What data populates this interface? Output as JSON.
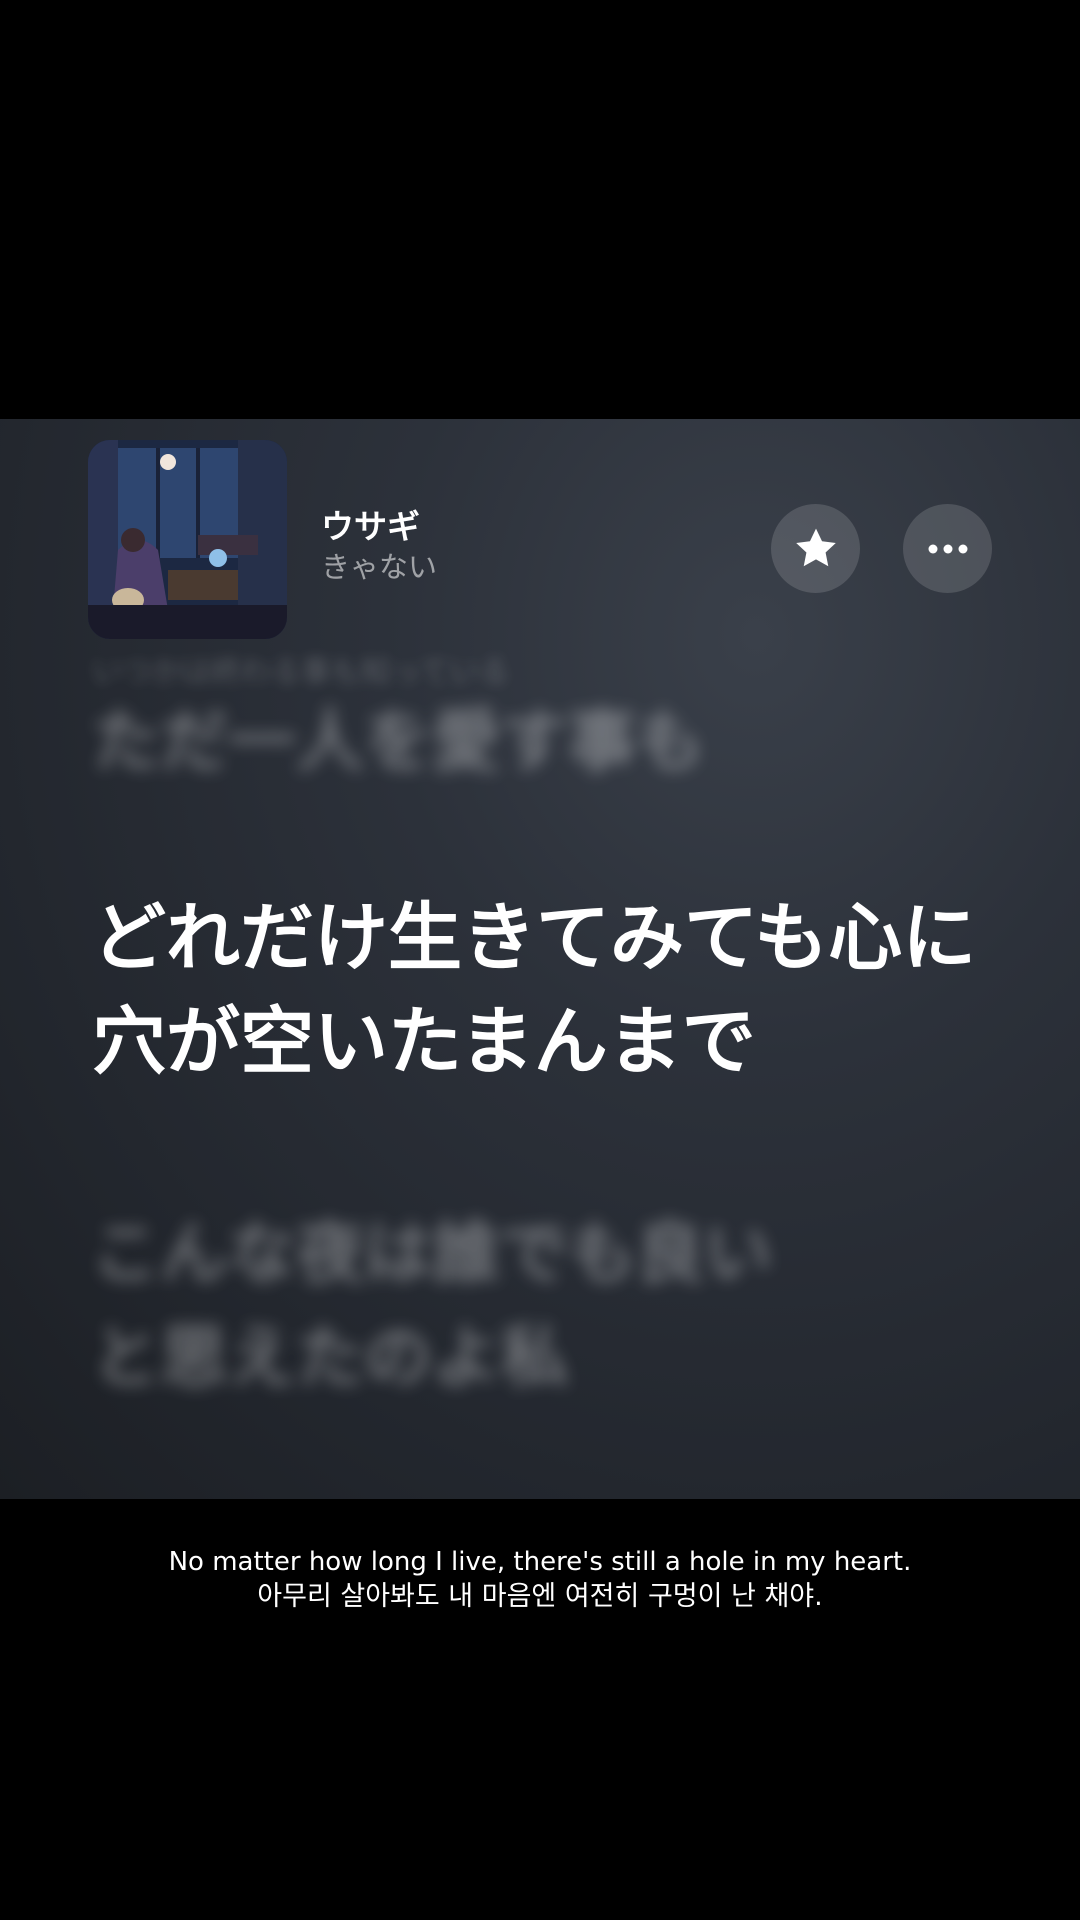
{
  "now_playing": {
    "title": "ウサギ",
    "artist": "きゃない",
    "favorite_icon": "star-icon",
    "more_icon": "ellipsis-icon"
  },
  "lyrics": {
    "previous_small": "いつかは終わる事も知っている",
    "previous": "ただ一人を愛す事も",
    "current": "どれだけ生きてみても心に穴が空いたまんまで",
    "next": "こんな夜は誰でも良いと思えたのよ私"
  },
  "subtitles": {
    "english": "No matter how long I live, there's still a hole in my heart.",
    "korean": "아무리 살아봐도 내 마음엔 여전히 구멍이 난 채야."
  }
}
